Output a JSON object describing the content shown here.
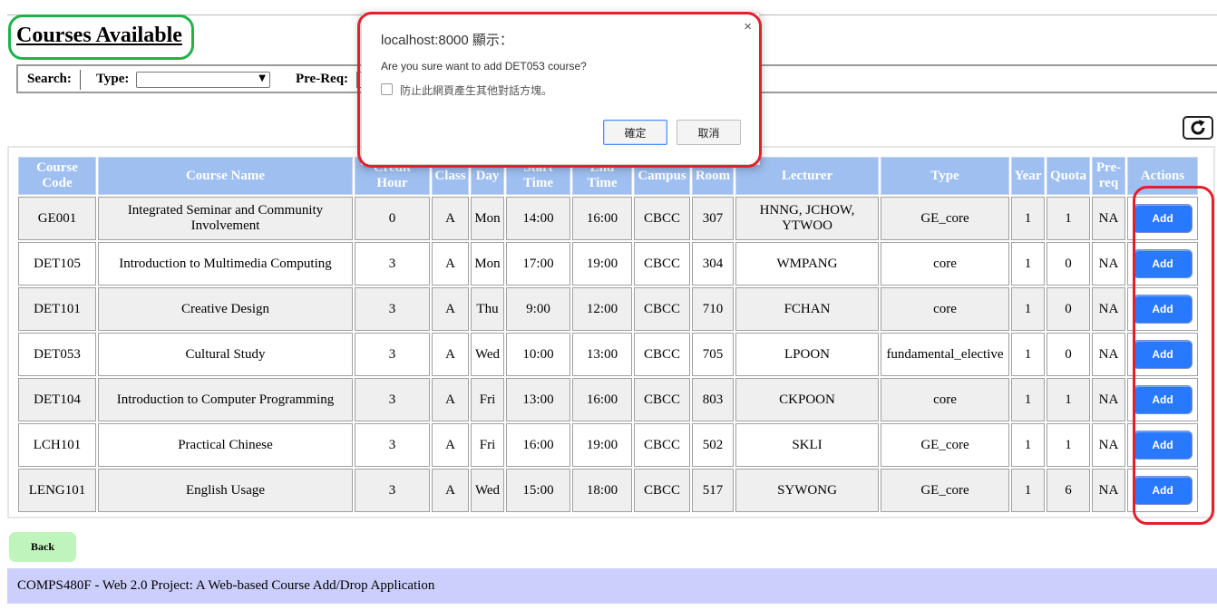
{
  "page": {
    "title": "Courses Available"
  },
  "search": {
    "search_label": "Search:",
    "type_label": "Type:",
    "type_value": "",
    "prereq_label": "Pre-Req:"
  },
  "icons": {
    "refresh": "refresh-icon",
    "dropdown": "chevron-down-icon"
  },
  "table": {
    "headers": [
      "Course Code",
      "Course Name",
      "Credit Hour",
      "Class",
      "Day",
      "Start Time",
      "End Time",
      "Campus",
      "Room",
      "Lecturer",
      "Type",
      "Year",
      "Quota",
      "Pre-req",
      "Actions"
    ],
    "action_label": "Add",
    "rows": [
      {
        "code": "GE001",
        "name": "Integrated Seminar and Community Involvement",
        "credit": "0",
        "class": "A",
        "day": "Mon",
        "start": "14:00",
        "end": "16:00",
        "campus": "CBCC",
        "room": "307",
        "lecturer": "HNNG, JCHOW, YTWOO",
        "type": "GE_core",
        "year": "1",
        "quota": "1",
        "prereq": "NA"
      },
      {
        "code": "DET105",
        "name": "Introduction to Multimedia Computing",
        "credit": "3",
        "class": "A",
        "day": "Mon",
        "start": "17:00",
        "end": "19:00",
        "campus": "CBCC",
        "room": "304",
        "lecturer": "WMPANG",
        "type": "core",
        "year": "1",
        "quota": "0",
        "prereq": "NA"
      },
      {
        "code": "DET101",
        "name": "Creative Design",
        "credit": "3",
        "class": "A",
        "day": "Thu",
        "start": "9:00",
        "end": "12:00",
        "campus": "CBCC",
        "room": "710",
        "lecturer": "FCHAN",
        "type": "core",
        "year": "1",
        "quota": "0",
        "prereq": "NA"
      },
      {
        "code": "DET053",
        "name": "Cultural Study",
        "credit": "3",
        "class": "A",
        "day": "Wed",
        "start": "10:00",
        "end": "13:00",
        "campus": "CBCC",
        "room": "705",
        "lecturer": "LPOON",
        "type": "fundamental_elective",
        "year": "1",
        "quota": "0",
        "prereq": "NA"
      },
      {
        "code": "DET104",
        "name": "Introduction to Computer Programming",
        "credit": "3",
        "class": "A",
        "day": "Fri",
        "start": "13:00",
        "end": "16:00",
        "campus": "CBCC",
        "room": "803",
        "lecturer": "CKPOON",
        "type": "core",
        "year": "1",
        "quota": "1",
        "prereq": "NA"
      },
      {
        "code": "LCH101",
        "name": "Practical Chinese",
        "credit": "3",
        "class": "A",
        "day": "Fri",
        "start": "16:00",
        "end": "19:00",
        "campus": "CBCC",
        "room": "502",
        "lecturer": "SKLI",
        "type": "GE_core",
        "year": "1",
        "quota": "1",
        "prereq": "NA"
      },
      {
        "code": "LENG101",
        "name": "English Usage",
        "credit": "3",
        "class": "A",
        "day": "Wed",
        "start": "15:00",
        "end": "18:00",
        "campus": "CBCC",
        "room": "517",
        "lecturer": "SYWONG",
        "type": "GE_core",
        "year": "1",
        "quota": "6",
        "prereq": "NA"
      }
    ]
  },
  "back_button": "Back",
  "footer": "COMPS480F - Web 2.0 Project: A Web-based Course Add/Drop Application",
  "dialog": {
    "title": "localhost:8000 顯示：",
    "close": "×",
    "message": "Are you sure want to add DET053 course?",
    "checkbox_label": "防止此網頁產生其他對話方塊。",
    "ok": "確定",
    "cancel": "取消"
  },
  "colors": {
    "header_bg": "#9ebff0",
    "add_button": "#2979ff",
    "back_button": "#bff5bd",
    "footer_bg": "#cccffb",
    "annotation_green": "#1fb24a",
    "annotation_red": "#e2202c"
  }
}
